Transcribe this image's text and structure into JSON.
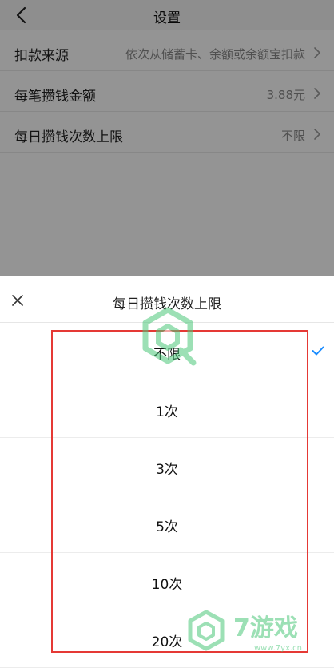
{
  "navbar": {
    "title": "设置",
    "back_icon": "chevron-left-icon"
  },
  "settings": [
    {
      "label": "扣款来源",
      "value": "依次从储蓄卡、余额或余额宝扣款"
    },
    {
      "label": "每笔攒钱金额",
      "value": "3.88元"
    },
    {
      "label": "每日攒钱次数上限",
      "value": "不限"
    }
  ],
  "sheet": {
    "title": "每日攒钱次数上限",
    "close_icon": "close-icon",
    "selected_index": 0,
    "options": [
      "不限",
      "1次",
      "3次",
      "5次",
      "10次",
      "20次"
    ]
  },
  "watermark": {
    "text": "7游戏",
    "url": "www.7yx.cn"
  },
  "colors": {
    "accent": "#1a8cff",
    "highlight": "#e53935",
    "watermark": "#4cc77a"
  }
}
